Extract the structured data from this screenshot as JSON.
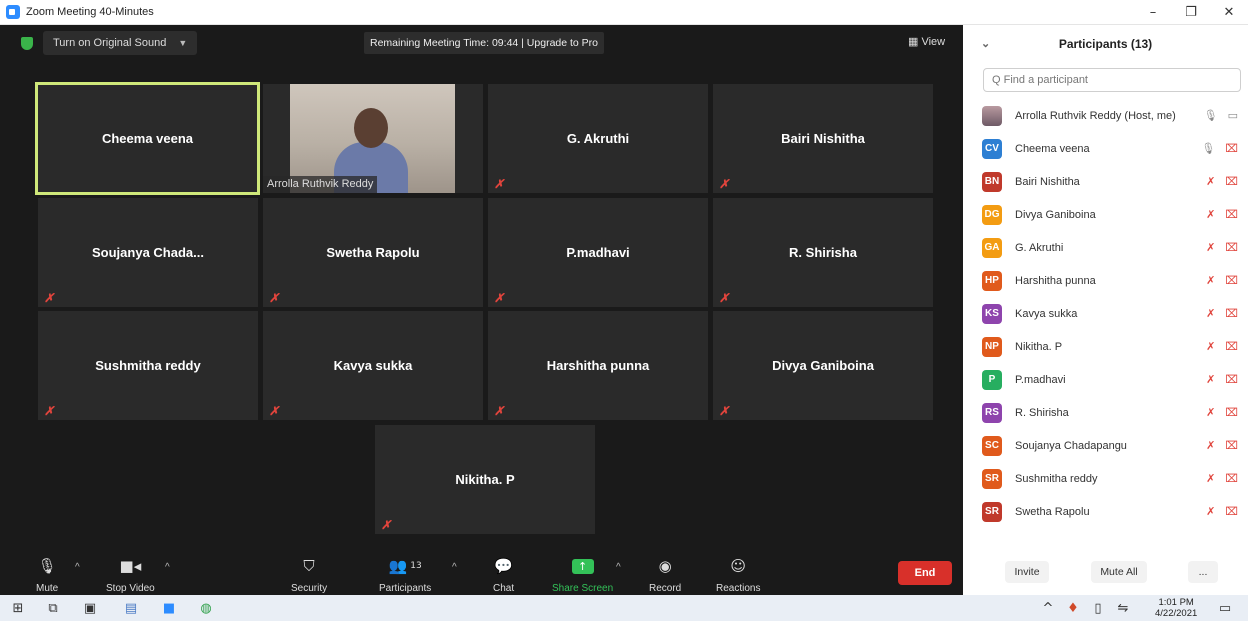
{
  "window": {
    "title": "Zoom Meeting 40-Minutes",
    "minimize": "–",
    "restore": "❐",
    "close": "✕"
  },
  "topbar": {
    "original_sound": "Turn on Original Sound",
    "remaining": "Remaining Meeting Time: 09:44 | Upgrade to Pro",
    "view": "View"
  },
  "tiles": [
    {
      "name": "Cheema veena"
    },
    {
      "name": "Arrolla Ruthvik Reddy"
    },
    {
      "name": "G. Akruthi"
    },
    {
      "name": "Bairi Nishitha"
    },
    {
      "name": "Soujanya  Chada..."
    },
    {
      "name": "Swetha Rapolu"
    },
    {
      "name": "P.madhavi"
    },
    {
      "name": "R. Shirisha"
    },
    {
      "name": "Sushmitha reddy"
    },
    {
      "name": "Kavya sukka"
    },
    {
      "name": "Harshitha punna"
    },
    {
      "name": "Divya Ganiboina"
    },
    {
      "name": "Nikitha. P"
    }
  ],
  "toolbar": {
    "mute": "Mute",
    "stop_video": "Stop Video",
    "security": "Security",
    "participants": "Participants",
    "participants_count": "13",
    "chat": "Chat",
    "share_screen": "Share Screen",
    "record": "Record",
    "reactions": "Reactions",
    "end": "End"
  },
  "panel": {
    "title": "Participants (13)",
    "search_placeholder": "Q Find a participant",
    "participants": [
      {
        "initials": "",
        "name": "Arrolla Ruthvik Reddy (Host, me)",
        "color": "",
        "muted": false
      },
      {
        "initials": "CV",
        "name": "Cheema veena",
        "color": "#2d7fd3",
        "muted": false
      },
      {
        "initials": "BN",
        "name": "Bairi Nishitha",
        "color": "#c0392b",
        "muted": true
      },
      {
        "initials": "DG",
        "name": "Divya Ganiboina",
        "color": "#f39c12",
        "muted": true
      },
      {
        "initials": "GA",
        "name": "G. Akruthi",
        "color": "#f39c12",
        "muted": true
      },
      {
        "initials": "HP",
        "name": "Harshitha punna",
        "color": "#e05a1c",
        "muted": true
      },
      {
        "initials": "KS",
        "name": "Kavya sukka",
        "color": "#8e44ad",
        "muted": true
      },
      {
        "initials": "NP",
        "name": "Nikitha. P",
        "color": "#e05a1c",
        "muted": true
      },
      {
        "initials": "P",
        "name": "P.madhavi",
        "color": "#27ae60",
        "muted": true
      },
      {
        "initials": "RS",
        "name": "R. Shirisha",
        "color": "#8e44ad",
        "muted": true
      },
      {
        "initials": "SC",
        "name": "Soujanya Chadapangu",
        "color": "#e05a1c",
        "muted": true
      },
      {
        "initials": "SR",
        "name": "Sushmitha reddy",
        "color": "#e05a1c",
        "muted": true
      },
      {
        "initials": "SR",
        "name": "Swetha Rapolu",
        "color": "#c0392b",
        "muted": true
      }
    ],
    "invite": "Invite",
    "mute_all": "Mute All",
    "more": "..."
  },
  "taskbar": {
    "time": "1:01 PM",
    "date": "4/22/2021"
  }
}
